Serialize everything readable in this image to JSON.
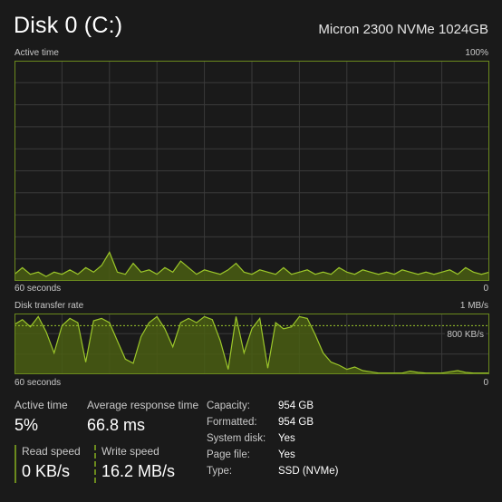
{
  "header": {
    "title": "Disk 0 (C:)",
    "model": "Micron 2300 NVMe 1024GB"
  },
  "active_chart": {
    "label": "Active time",
    "max_label": "100%",
    "time_label": "60 seconds",
    "min_label": "0"
  },
  "transfer_chart": {
    "label": "Disk transfer rate",
    "max_label": "1 MB/s",
    "mid_label": "800 KB/s",
    "time_label": "60 seconds",
    "min_label": "0"
  },
  "stats": {
    "active_time": {
      "label": "Active time",
      "value": "5%"
    },
    "avg_response": {
      "label": "Average response time",
      "value": "66.8 ms"
    },
    "read_speed": {
      "label": "Read speed",
      "value": "0 KB/s"
    },
    "write_speed": {
      "label": "Write speed",
      "value": "16.2 MB/s"
    }
  },
  "properties": [
    {
      "key": "Capacity:",
      "value": "954 GB"
    },
    {
      "key": "Formatted:",
      "value": "954 GB"
    },
    {
      "key": "System disk:",
      "value": "Yes"
    },
    {
      "key": "Page file:",
      "value": "Yes"
    },
    {
      "key": "Type:",
      "value": "SSD (NVMe)"
    }
  ],
  "colors": {
    "background": "#1a1a1a",
    "grid": "#3a3a3a",
    "border": "#6b8a1d",
    "fill": "#4a5e13",
    "line": "#9cc72a"
  },
  "chart_data": [
    {
      "type": "area",
      "title": "Active time",
      "ylim": [
        0,
        100
      ],
      "xlim": [
        60,
        0
      ],
      "values": [
        3,
        6,
        3,
        4,
        2,
        4,
        3,
        5,
        3,
        6,
        4,
        7,
        13,
        4,
        3,
        8,
        4,
        5,
        3,
        6,
        4,
        9,
        6,
        3,
        5,
        4,
        3,
        5,
        8,
        4,
        3,
        5,
        4,
        3,
        6,
        3,
        4,
        5,
        3,
        4,
        3,
        6,
        4,
        3,
        5,
        4,
        3,
        4,
        3,
        5,
        4,
        3,
        4,
        3,
        4,
        5,
        3,
        6,
        4,
        3,
        4
      ],
      "grid": true
    },
    {
      "type": "area",
      "title": "Disk transfer rate",
      "ylim": [
        0,
        1
      ],
      "xlim": [
        60,
        0
      ],
      "values": [
        0.82,
        0.9,
        0.78,
        0.95,
        0.7,
        0.35,
        0.8,
        0.92,
        0.85,
        0.2,
        0.88,
        0.92,
        0.85,
        0.55,
        0.25,
        0.18,
        0.62,
        0.85,
        0.95,
        0.75,
        0.45,
        0.85,
        0.92,
        0.85,
        0.95,
        0.9,
        0.55,
        0.08,
        0.95,
        0.35,
        0.75,
        0.92,
        0.1,
        0.85,
        0.75,
        0.78,
        0.95,
        0.92,
        0.65,
        0.35,
        0.2,
        0.15,
        0.08,
        0.12,
        0.06,
        0.04,
        0.02,
        0.02,
        0.02,
        0.02,
        0.05,
        0.03,
        0.02,
        0.02,
        0.02,
        0.04,
        0.06,
        0.03,
        0.02,
        0.02,
        0.02
      ],
      "grid": true
    }
  ]
}
